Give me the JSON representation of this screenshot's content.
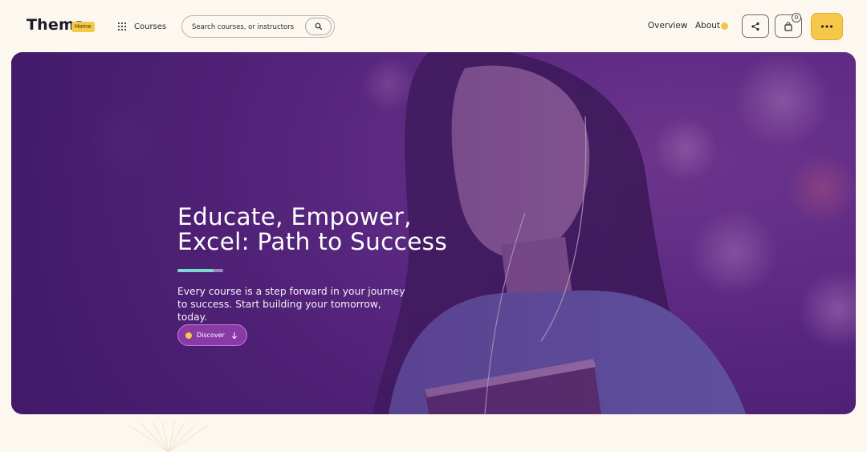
{
  "header": {
    "logo": "Thema",
    "home_badge": "Home",
    "courses_label": "Courses",
    "search": {
      "placeholder": "Search courses, or instructors",
      "value": ""
    },
    "nav": {
      "overview": "Overview",
      "about": "About"
    },
    "cart_count": "0",
    "icons": [
      "grid-icon",
      "search-icon",
      "share-icon",
      "shopping-bag-icon",
      "more-horizontal-icon"
    ]
  },
  "hero": {
    "title_line1": "Educate, Empower,",
    "title_line2": "Excel: Path to Success",
    "description": "Every course is a step forward in your journey to success. Start building your tomorrow, today.",
    "cta_label": "Discover",
    "cta_icon": "arrow-down-icon"
  },
  "colors": {
    "page_bg": "#fcf8ef",
    "accent_yellow": "#f6c84a",
    "hero_purple": "#5f2a84",
    "cta_purple": "#8a3aa7",
    "bar_teal": "#7ad8d0"
  }
}
